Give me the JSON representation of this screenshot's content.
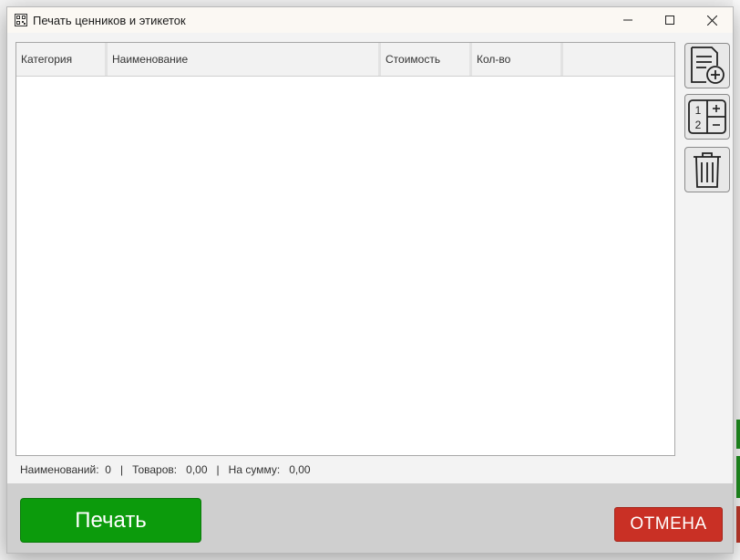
{
  "window": {
    "title": "Печать ценников и этикеток",
    "icon": "qr-code-icon"
  },
  "table": {
    "columns": [
      "Категория",
      "Наименование",
      "Стоимость",
      "Кол-во",
      ""
    ],
    "rows": []
  },
  "side_toolbar": {
    "add_doc_icon": "add-document-icon",
    "quantity_icon": "quantity-plus-minus-icon",
    "delete_icon": "trash-icon",
    "qty_digits": [
      "1",
      "2"
    ]
  },
  "status": {
    "items_label": "Наименований:",
    "items_value": "0",
    "goods_label": "Товаров:",
    "goods_value": "0,00",
    "sum_label": "На сумму:",
    "sum_value": "0,00",
    "separator": "|"
  },
  "buttons": {
    "print": "Печать",
    "cancel": "ОТМЕНА"
  },
  "colors": {
    "print_bg": "#0c9b0c",
    "cancel_bg": "#c93025"
  }
}
